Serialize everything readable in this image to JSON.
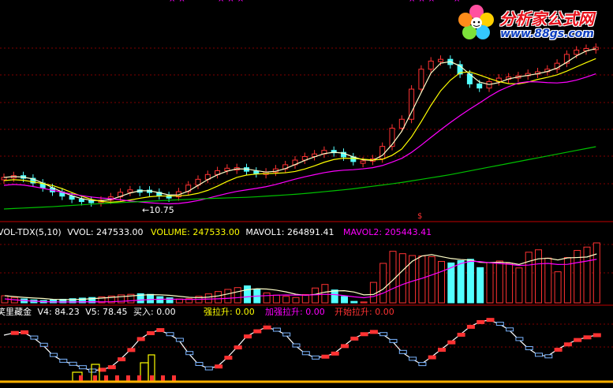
{
  "watermark": {
    "site_name": "分析家公式网",
    "url": "www.88gs.com"
  },
  "price_panel": {
    "low_marker": "10.75",
    "low_marker_arrow": "←",
    "top_markers": [
      "×",
      "×",
      "×",
      "×",
      "×",
      "×",
      "×",
      "×",
      "×"
    ],
    "bottom_marker": "$"
  },
  "volume_panel": {
    "indicator_name": "VOL-TDX(5,10)",
    "vvol_label": "VVOL:",
    "vvol_value": "247533.00",
    "volume_label": "VOLUME:",
    "volume_value": "247533.00",
    "mavol1_label": "MAVOL1:",
    "mavol1_value": "264891.41",
    "mavol2_label": "MAVOL2:",
    "mavol2_value": "205443.41"
  },
  "indicator_panel": {
    "name": "笑里藏金",
    "v4_label": "V4:",
    "v4_value": "84.23",
    "v5_label": "V5:",
    "v5_value": "78.45",
    "buy_label": "买入:",
    "buy_value": "0.00",
    "strong_label": "强拉升:",
    "strong_value": "0.00",
    "enhanced_label": "加强拉升:",
    "enhanced_value": "0.00",
    "start_label": "开始拉升:",
    "start_value": "0.00"
  },
  "colors": {
    "background": "#000000",
    "up_candle": "#ff3232",
    "down_candle": "#54ffff",
    "ma_short": "#ffffc8",
    "ma_mid": "#ffff00",
    "ma_long": "#ff00ff",
    "ma_xlong": "#00c000",
    "grid": "#800000",
    "white_text": "#ffffff",
    "magenta_text": "#ff00ff",
    "yellow_text": "#ffff00",
    "red_text": "#ff3232",
    "logo_red": "#e8101a",
    "logo_blue": "#1040c0"
  }
}
